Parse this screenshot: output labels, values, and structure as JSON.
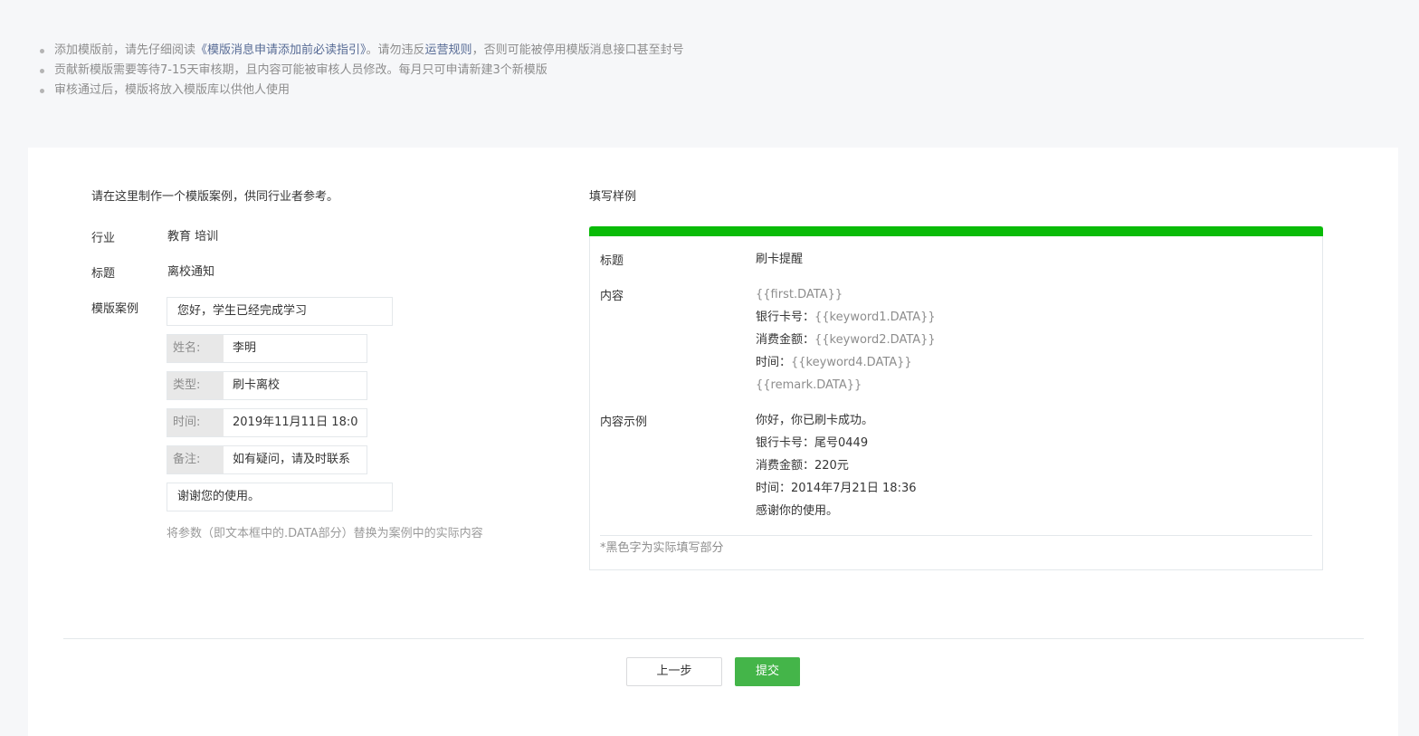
{
  "notes": {
    "n1_a": "添加模版前，请先仔细阅读",
    "n1_link1": "《模版消息申请添加前必读指引》",
    "n1_b": "。请勿违反",
    "n1_link2": "运营规则",
    "n1_c": "，否则可能被停用模版消息接口甚至封号",
    "n2": "贡献新模版需要等待7-15天审核期，且内容可能被审核人员修改。每月只可申请新建3个新模版",
    "n3": "审核通过后，模版将放入模版库以供他人使用"
  },
  "form": {
    "intro": "请在这里制作一个模版案例，供同行业者参考。",
    "industry_label": "行业",
    "industry_value": "教育 培训",
    "title_label": "标题",
    "title_value": "离校通知",
    "case_label": "模版案例",
    "first": "您好，学生已经完成学习",
    "fields": [
      {
        "key": "姓名:",
        "value": "李明"
      },
      {
        "key": "类型:",
        "value": "刷卡离校"
      },
      {
        "key": "时间:",
        "value": "2019年11月11日  18:0"
      },
      {
        "key": "备注:",
        "value": "如有疑问，请及时联系"
      }
    ],
    "remark": "谢谢您的使用。",
    "hint": "将参数（即文本框中的.DATA部分）替换为案例中的实际内容"
  },
  "sample": {
    "heading": "填写样例",
    "accent_color": "#09bb07",
    "title_label": "标题",
    "title_value": "刷卡提醒",
    "content_label": "内容",
    "content": {
      "l1": "{{first.DATA}}",
      "l2_k": "银行卡号：",
      "l2_v": "{{keyword1.DATA}}",
      "l3_k": "消费金额：",
      "l3_v": "{{keyword2.DATA}}",
      "l4_k": "时间：",
      "l4_v": "{{keyword4.DATA}}",
      "l5": "{{remark.DATA}}"
    },
    "example_label": "内容示例",
    "example": {
      "l1": "你好，你已刷卡成功。",
      "l2": "银行卡号：尾号0449",
      "l3": "消费金额：220元",
      "l4": "时间：2014年7月21日 18:36",
      "l5": "感谢你的使用。"
    },
    "footnote": "*黑色字为实际填写部分"
  },
  "buttons": {
    "prev": "上一步",
    "submit": "提交",
    "submit_color": "#44b549"
  }
}
